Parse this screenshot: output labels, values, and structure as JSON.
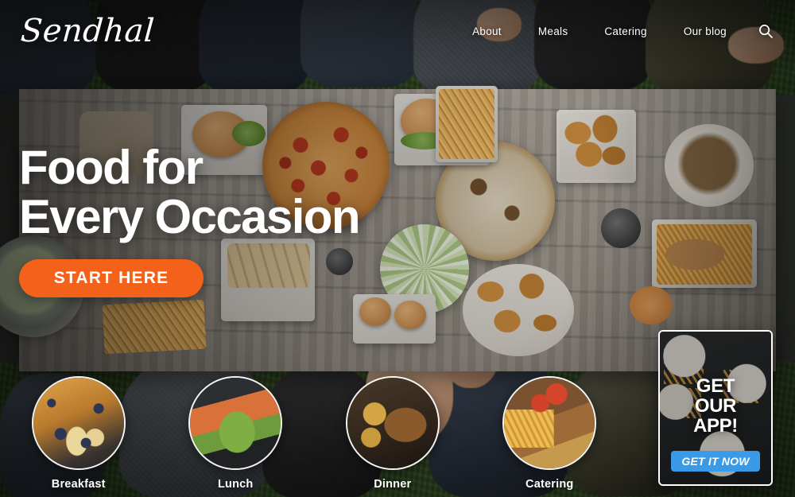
{
  "site": {
    "brand": "Sendhal",
    "nav": [
      {
        "label": "About"
      },
      {
        "label": "Meals"
      },
      {
        "label": "Catering"
      },
      {
        "label": "Our blog"
      }
    ],
    "search_icon": "search-icon"
  },
  "hero": {
    "heading": "Food for\nEvery Occasion",
    "cta_label": "START HERE"
  },
  "categories": [
    {
      "label": "Breakfast",
      "image": "french-toast-blueberries-banana"
    },
    {
      "label": "Lunch",
      "image": "salmon-fillet-greens-plate"
    },
    {
      "label": "Dinner",
      "image": "grilled-meat-roast-potatoes-bowl"
    },
    {
      "label": "Catering",
      "image": "kebab-fries-tomato-platter"
    }
  ],
  "promo": {
    "headline": "GET\nOUR\nAPP!",
    "button_label": "GET IT NOW",
    "background_image": "overhead-table-burgers-fries-drinks"
  },
  "background": {
    "image": "overhead-picnic-table-pizza-burgers-fries-salad-wings",
    "description": "Top-down photo of friends around a weathered wooden picnic table on grass, loaded with pizzas, burgers, fries, salad and chicken wings"
  },
  "colors": {
    "accent_orange": "#f4611b",
    "accent_blue": "#3b9ae8",
    "text_light": "#ffffff",
    "table_wood": "#a39d94",
    "grass_green": "#46603a"
  }
}
